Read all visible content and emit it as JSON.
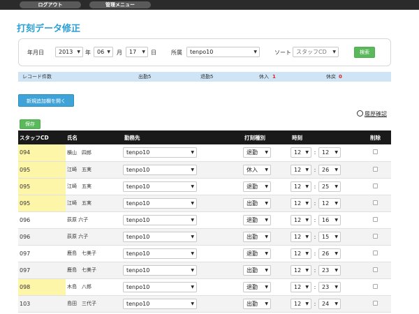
{
  "topbar": {
    "logout": "ログアウト",
    "admin_menu": "管理メニュー"
  },
  "page_title": "打刻データ修正",
  "filter": {
    "date_label": "年月日",
    "year": "2013",
    "year_unit": "年",
    "month": "06",
    "month_unit": "月",
    "day": "17",
    "day_unit": "日",
    "dept_label": "所属",
    "dept": "tenpo10",
    "sort_label": "ソート",
    "sort": "スタッフCD",
    "search_button": "検索"
  },
  "counts": {
    "records_label": "レコード件数",
    "shukkin": "出勤5",
    "taikin": "退勤5",
    "kyuunyu_label": "休入",
    "kyuunyu_val": "1",
    "kyuushutsu_label": "休戻",
    "kyuushutsu_val": "0"
  },
  "new_button": "新規追加欄を開く",
  "history_link": "履歴確認",
  "save_button": "保存",
  "table": {
    "headers": [
      "スタッフCD",
      "氏名",
      "勤務先",
      "打刻種別",
      "時刻",
      "削除"
    ],
    "rows": [
      {
        "code": "094",
        "name": "横山　四郎",
        "place": "tenpo10",
        "type": "退勤",
        "hour": "12",
        "min": "12",
        "hl": true
      },
      {
        "code": "095",
        "name": "江崎　五実",
        "place": "tenpo10",
        "type": "休入",
        "hour": "12",
        "min": "26",
        "hl": true
      },
      {
        "code": "095",
        "name": "江崎　五実",
        "place": "tenpo10",
        "type": "退勤",
        "hour": "12",
        "min": "25",
        "hl": true
      },
      {
        "code": "095",
        "name": "江崎　五実",
        "place": "tenpo10",
        "type": "出勤",
        "hour": "12",
        "min": "12",
        "hl": true
      },
      {
        "code": "096",
        "name": "荻原 六子",
        "place": "tenpo10",
        "type": "退勤",
        "hour": "12",
        "min": "16",
        "hl": false
      },
      {
        "code": "096",
        "name": "荻原 六子",
        "place": "tenpo10",
        "type": "出勤",
        "hour": "12",
        "min": "15",
        "hl": false
      },
      {
        "code": "097",
        "name": "鹿島　七美子",
        "place": "tenpo10",
        "type": "退勤",
        "hour": "12",
        "min": "26",
        "hl": false
      },
      {
        "code": "097",
        "name": "鹿島　七美子",
        "place": "tenpo10",
        "type": "出勤",
        "hour": "12",
        "min": "23",
        "hl": false
      },
      {
        "code": "098",
        "name": "木島　八郎",
        "place": "tenpo10",
        "type": "退勤",
        "hour": "12",
        "min": "23",
        "hl": true
      },
      {
        "code": "103",
        "name": "島田　三代子",
        "place": "tenpo10",
        "type": "出勤",
        "hour": "12",
        "min": "24",
        "hl": false
      }
    ]
  }
}
